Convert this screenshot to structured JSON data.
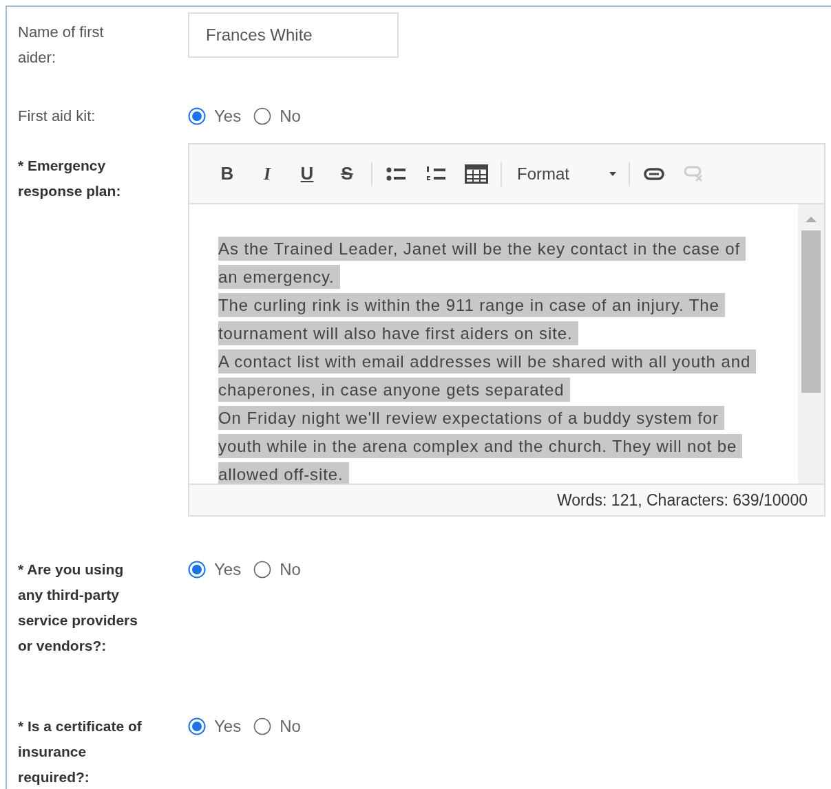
{
  "fields": [
    {
      "kind": "text",
      "label": "Name of first aider:",
      "required": false,
      "value": "Frances White"
    },
    {
      "kind": "radio",
      "label": "First aid kit:",
      "required": false,
      "options": [
        {
          "label": "Yes",
          "selected": true
        },
        {
          "label": "No",
          "selected": false
        }
      ]
    },
    {
      "kind": "editor",
      "label": "* Emergency response plan:",
      "required": true,
      "toolbar": [
        {
          "kind": "bold",
          "label": "B"
        },
        {
          "kind": "italic",
          "label": "I"
        },
        {
          "kind": "underline",
          "label": "U"
        },
        {
          "kind": "strike",
          "label": "S"
        },
        {
          "kind": "separator"
        },
        {
          "kind": "bulleted-list"
        },
        {
          "kind": "numbered-list"
        },
        {
          "kind": "table"
        },
        {
          "kind": "separator"
        },
        {
          "kind": "dropdown",
          "label": "Format"
        },
        {
          "kind": "separator"
        },
        {
          "kind": "link",
          "disabled": false
        },
        {
          "kind": "unlink",
          "disabled": true
        }
      ],
      "selected": true,
      "lines": [
        "As the Trained Leader, Janet will be the key contact in the case of",
        "an emergency.",
        "The curling rink is within the 911 range in case of an injury. The",
        "tournament will also have first aiders on site.",
        "A contact list with email addresses will be shared with all youth and",
        "chaperones, in case anyone gets separated",
        "On Friday night we'll review expectations of a buddy system for",
        "youth while in the arena complex and the church. They will not be",
        "allowed off-site."
      ],
      "status": "Words: 121, Characters: 639/10000"
    },
    {
      "kind": "radio",
      "label": "* Are you using any third-party service providers or vendors?:",
      "required": true,
      "options": [
        {
          "label": "Yes",
          "selected": true
        },
        {
          "label": "No",
          "selected": false
        }
      ]
    },
    {
      "kind": "radio",
      "label": "* Is a certificate of insurance required?:",
      "required": true,
      "options": [
        {
          "label": "Yes",
          "selected": true
        },
        {
          "label": "No",
          "selected": false
        }
      ]
    }
  ]
}
